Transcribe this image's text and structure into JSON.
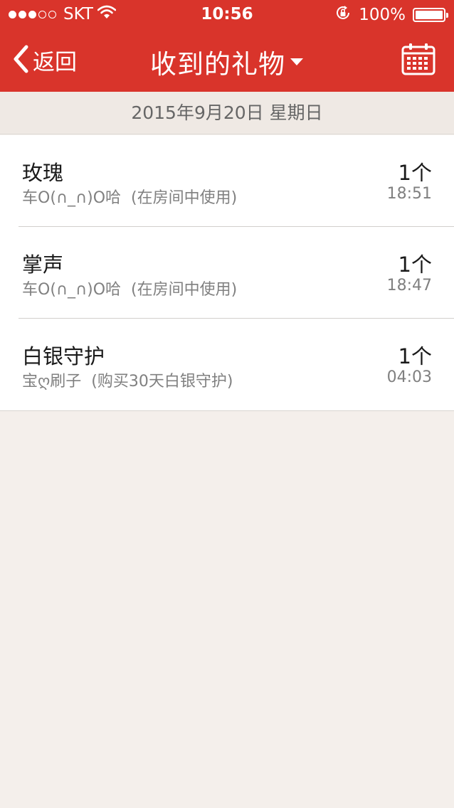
{
  "status_bar": {
    "carrier": "SKT",
    "time": "10:56",
    "battery_percent": "100%",
    "signal_bars_filled": 3,
    "signal_bars_total": 5,
    "icons": [
      "signal-dots-icon",
      "wifi-icon",
      "orientation-lock-icon",
      "battery-icon"
    ]
  },
  "navbar": {
    "back_label": "返回",
    "title": "收到的礼物",
    "title_icon": "caret-down-icon",
    "right_icon": "calendar-icon",
    "background_color": "#d9342b"
  },
  "date_header": "2015年9月20日 星期日",
  "gifts": [
    {
      "name": "玫瑰",
      "count": "1个",
      "sender": "车O(∩_∩)O哈",
      "note": "(在房间中使用)",
      "time": "18:51"
    },
    {
      "name": "掌声",
      "count": "1个",
      "sender": "车O(∩_∩)O哈",
      "note": "(在房间中使用)",
      "time": "18:47"
    },
    {
      "name": "白银守护",
      "count": "1个",
      "sender": "宝ღ刷子",
      "note": "(购买30天白银守护)",
      "time": "04:03"
    }
  ]
}
